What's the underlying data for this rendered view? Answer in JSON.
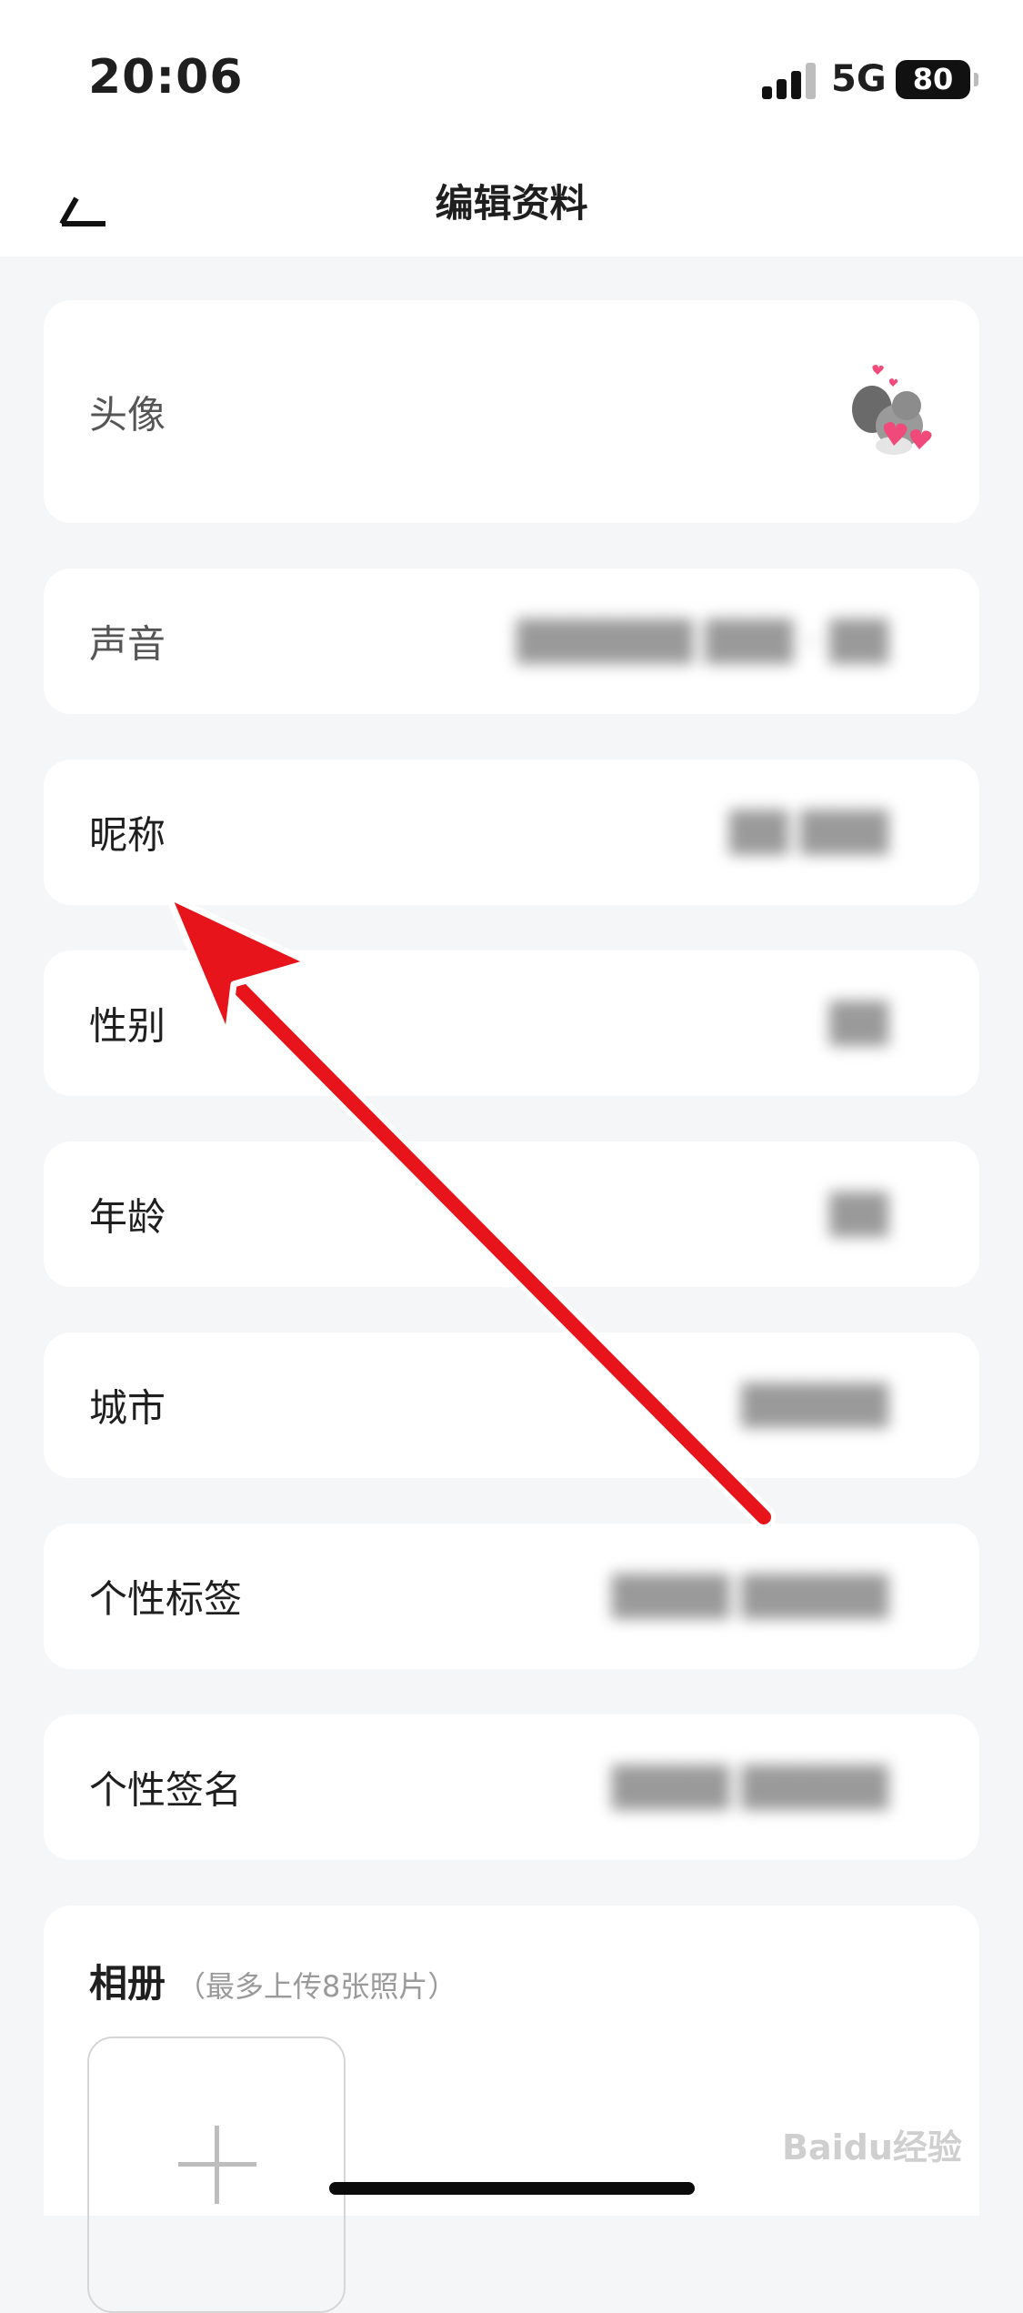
{
  "status_bar": {
    "time": "20:06",
    "network": "5G",
    "battery": "80"
  },
  "nav": {
    "title": "编辑资料"
  },
  "profile": {
    "avatar_label": "头像",
    "rows": [
      {
        "label": "声音",
        "value": "██████ ███ · ██"
      },
      {
        "label": "昵称",
        "value": "██ ███"
      },
      {
        "label": "性别",
        "value": "██"
      },
      {
        "label": "年龄",
        "value": "██"
      },
      {
        "label": "城市",
        "value": "█████"
      },
      {
        "label": "个性标签",
        "value": "████ █████"
      },
      {
        "label": "个性签名",
        "value": "████ █████"
      }
    ]
  },
  "album": {
    "title": "相册",
    "hint": "（最多上传8张照片）"
  },
  "watermark": "Baidu经验",
  "colors": {
    "annotation_arrow": "#e8141c",
    "background": "#f5f6f8"
  }
}
